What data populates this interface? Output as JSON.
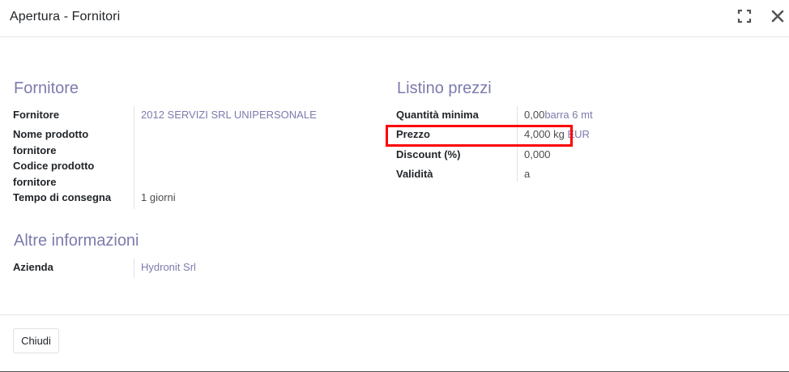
{
  "dialog": {
    "title": "Apertura - Fornitori"
  },
  "icons": {
    "expand": "expand-icon",
    "close": "close-icon"
  },
  "fornitore_section": {
    "title": "Fornitore",
    "fornitore_label": "Fornitore",
    "fornitore_value": "2012 SERVIZI SRL UNIPERSONALE",
    "nome_prodotto_label_1": "Nome prodotto",
    "nome_prodotto_label_2": "fornitore",
    "codice_prodotto_label_1": "Codice prodotto",
    "codice_prodotto_label_2": "fornitore",
    "tempo_consegna_label": "Tempo di consegna",
    "tempo_consegna_value": "1 giorni"
  },
  "listino_section": {
    "title": "Listino prezzi",
    "quantita_label": "Quantità minima",
    "quantita_value": "0,00",
    "quantita_unit": "barra 6 mt",
    "prezzo_label": "Prezzo",
    "prezzo_value": "4,000 kg",
    "prezzo_currency": "EUR",
    "discount_label": "Discount (%)",
    "discount_value": "0,000",
    "validita_label": "Validità",
    "validita_value": "a"
  },
  "altre_section": {
    "title": "Altre informazioni",
    "azienda_label": "Azienda",
    "azienda_value": "Hydronit Srl"
  },
  "footer": {
    "close_label": "Chiudi"
  },
  "colors": {
    "section_title": "#7c7bad",
    "link": "#7c7bad",
    "highlight": "#ff0000"
  }
}
